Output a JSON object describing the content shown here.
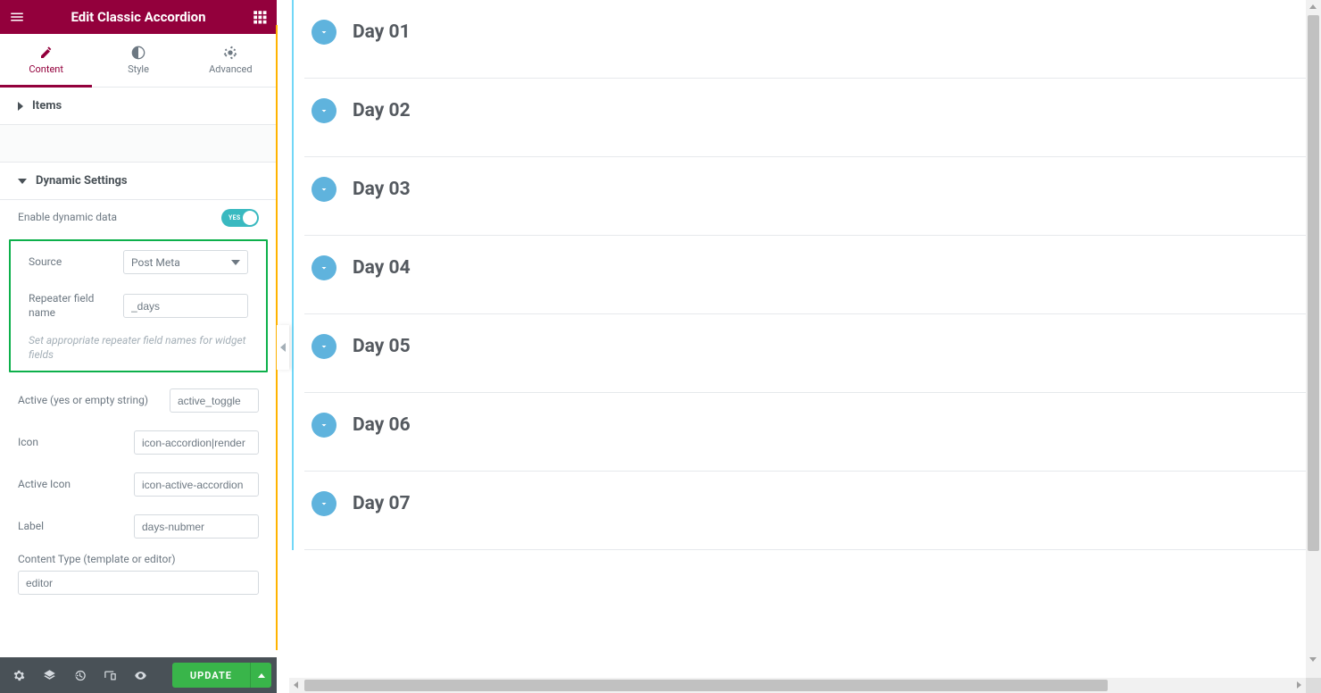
{
  "header": {
    "title": "Edit Classic Accordion"
  },
  "tabs": {
    "content": "Content",
    "style": "Style",
    "advanced": "Advanced"
  },
  "sections": {
    "items": "Items",
    "dynamic": "Dynamic Settings"
  },
  "dyn": {
    "enable_label": "Enable dynamic data",
    "toggle_text": "YES",
    "source_label": "Source",
    "source_value": "Post Meta",
    "repeater_label": "Repeater field name",
    "repeater_value": "_days",
    "hint": "Set appropriate repeater field names for widget fields",
    "active_label": "Active (yes or empty string)",
    "active_value": "active_toggle",
    "icon_label": "Icon",
    "icon_value": "icon-accordion|render",
    "activeicon_label": "Active Icon",
    "activeicon_value": "icon-active-accordion",
    "label_label": "Label",
    "label_value": "days-nubmer",
    "contenttype_label": "Content Type (template or editor)",
    "contenttype_value": "editor"
  },
  "footer": {
    "update": "UPDATE"
  },
  "accordion": {
    "items": [
      {
        "label": "Day 01"
      },
      {
        "label": "Day 02"
      },
      {
        "label": "Day 03"
      },
      {
        "label": "Day 04"
      },
      {
        "label": "Day 05"
      },
      {
        "label": "Day 06"
      },
      {
        "label": "Day 07"
      }
    ]
  }
}
